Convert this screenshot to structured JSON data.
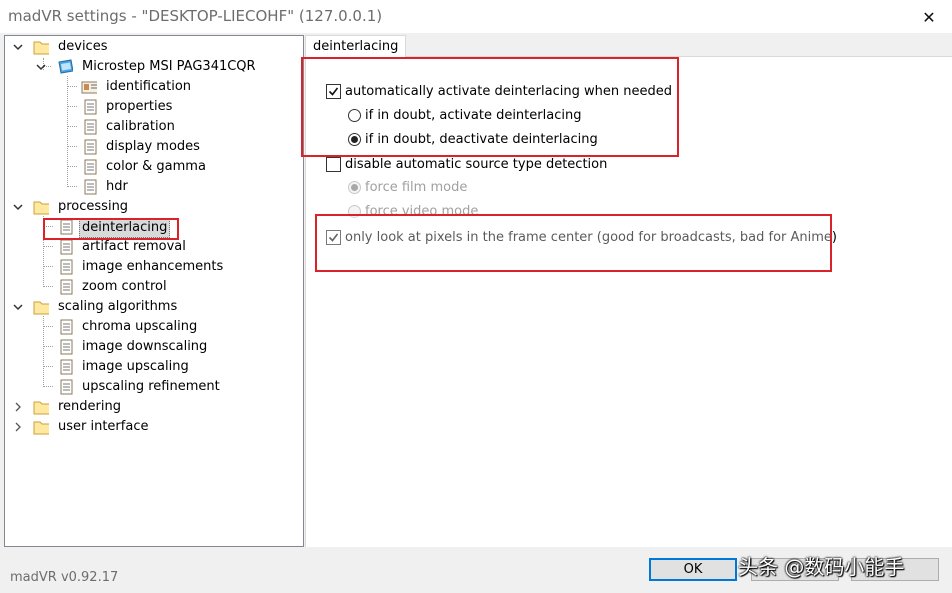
{
  "window": {
    "title": "madVR settings - \"DESKTOP-LIECOHF\" (127.0.0.1)",
    "close_glyph": "✕"
  },
  "tree": {
    "devices": "devices",
    "monitor": "Microstep MSI PAG341CQR",
    "identification": "identification",
    "properties": "properties",
    "calibration": "calibration",
    "display_modes": "display modes",
    "color_gamma": "color & gamma",
    "hdr": "hdr",
    "processing": "processing",
    "deinterlacing": "deinterlacing",
    "artifact_removal": "artifact removal",
    "image_enhancements": "image enhancements",
    "zoom_control": "zoom control",
    "scaling_algorithms": "scaling algorithms",
    "chroma_upscaling": "chroma upscaling",
    "image_downscaling": "image downscaling",
    "image_upscaling": "image upscaling",
    "upscaling_refinement": "upscaling refinement",
    "rendering": "rendering",
    "user_interface": "user interface",
    "selected": "deinterlacing"
  },
  "tab": {
    "label": "deinterlacing"
  },
  "options": {
    "auto_activate": {
      "label": "automatically activate deinterlacing when needed",
      "checked": true
    },
    "doubt_activate": {
      "label": "if in doubt, activate deinterlacing",
      "selected": false
    },
    "doubt_deactivate": {
      "label": "if in doubt, deactivate deinterlacing",
      "selected": true
    },
    "disable_detection": {
      "label": "disable automatic source type detection",
      "checked": false
    },
    "force_film": {
      "label": "force film mode",
      "selected": true,
      "disabled": true
    },
    "force_video": {
      "label": "force video mode",
      "selected": false,
      "disabled": true
    },
    "frame_center": {
      "label": "only look at pixels in the frame center  (good for broadcasts, bad for Anime)",
      "checked": true
    }
  },
  "footer": {
    "version": "madVR v0.92.17",
    "ok_label": "OK",
    "watermark": "头条 @数码小能手"
  },
  "colors": {
    "highlight_border": "#d9222a",
    "default_button_border": "#0078d7",
    "folder_fill": "#ffe8a0"
  }
}
